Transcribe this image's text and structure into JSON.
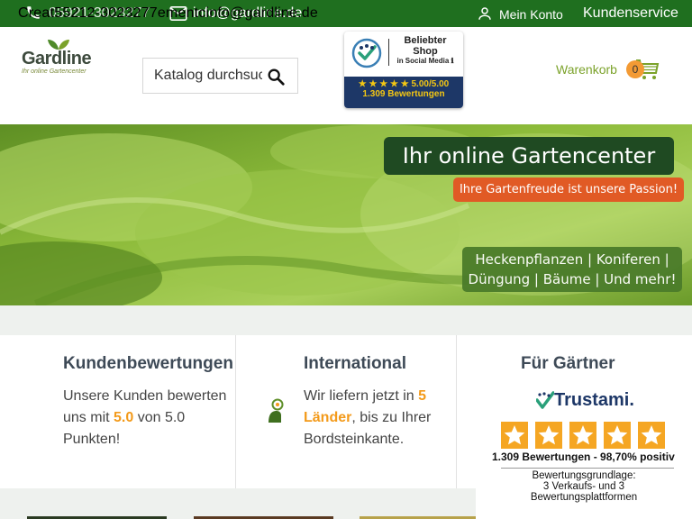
{
  "topbar": {
    "overlay_text": "Creat55212-3023277ementcinfo@gardline.de",
    "phone": "05921-3023277",
    "email": "info@gardline.de",
    "account_label": "Mein Konto",
    "service_label": "Kundenservice",
    "bg_color": "#1f6f1f",
    "icons": [
      "phone-icon",
      "mail-icon",
      "account-icon"
    ]
  },
  "header": {
    "logo": {
      "name": "Gardline",
      "tagline": "Ihr online Gartencenter"
    },
    "search": {
      "placeholder": "Katalog durchsuchen"
    },
    "badge": {
      "title": "Beliebter Shop",
      "subtitle": "in Social Media ℹ",
      "score": "★ ★ ★ ★ ★ 5.00/5.00",
      "reviews": "1.309 Bewertungen"
    },
    "cart": {
      "label": "Warenkorb",
      "count": "0"
    }
  },
  "hero": {
    "title": "Ihr online Gartencenter",
    "subtitle": "Ihre Gartenfreude ist unsere Passion!",
    "categories_line1": "Heckenpflanzen | Koniferen |",
    "categories_line2": "Düngung | Bäume | Und mehr!"
  },
  "features": {
    "reviews": {
      "title": "Kundenbewertungen",
      "text_before": "Unsere Kunden bewerten uns mit ",
      "score": "5.0",
      "text_after": " von 5.0 Punkten!"
    },
    "international": {
      "title": "International",
      "text_before": "Wir liefern jetzt in ",
      "highlight": "5 Länder",
      "text_after": ", bis zu Ihrer Bordsteinkante."
    },
    "gardeners": {
      "title": "Für Gärtner"
    }
  },
  "trustami": {
    "logo_text": "Trustami.",
    "rating": 5,
    "review_count": "1.309 Bewertungen - 98,70% positiv",
    "basis_line1": "Bewertungsgrundlage:",
    "basis_line2": "3 Verkaufs- und 3",
    "basis_line3": "Bewertungsplattformen"
  },
  "colors": {
    "accent_green": "#7ba22a",
    "highlight_orange": "#f39a1a",
    "badge_navy": "#1d3767",
    "star_gold": "#f5a623"
  }
}
